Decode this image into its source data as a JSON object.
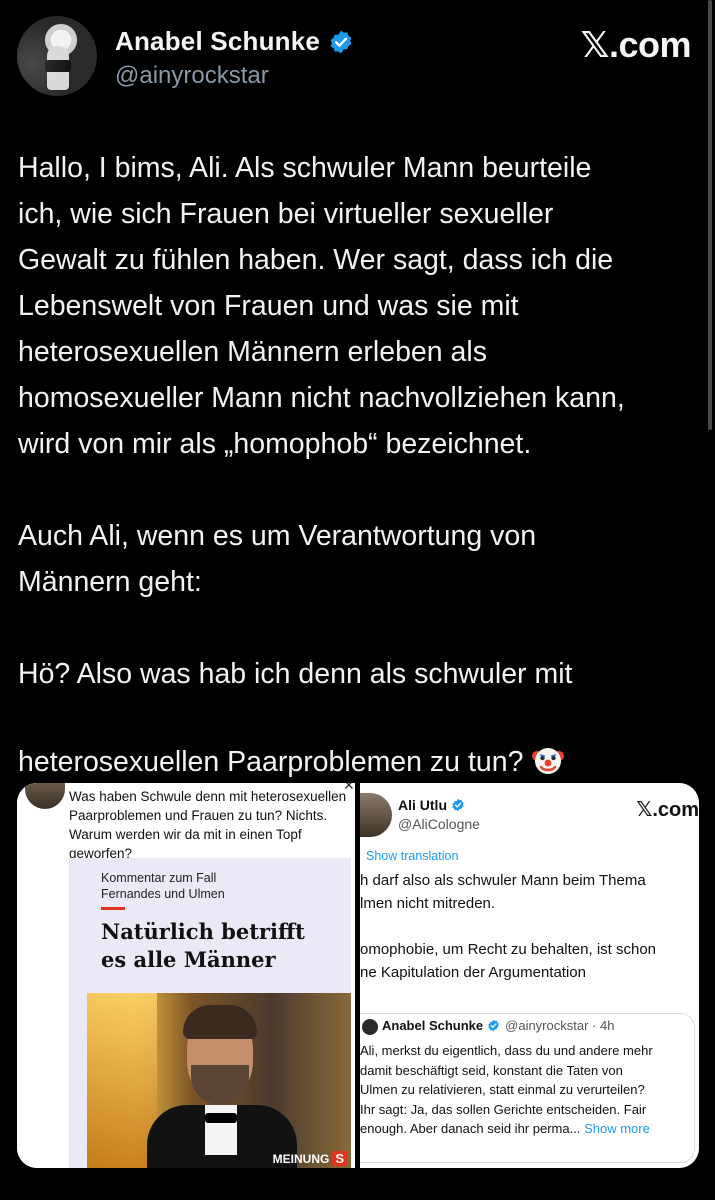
{
  "header": {
    "name": "Anabel Schunke",
    "handle": "@ainyrockstar",
    "site": "𝕏.com"
  },
  "tweet": {
    "paragraph1": "Hallo, I bims, Ali. Als schwuler Mann beurteile\nich, wie sich Frauen bei virtueller sexueller\nGewalt zu fühlen haben. Wer sagt, dass ich die\nLebenswelt von Frauen und was sie mit\nheterosexuellen Männern erleben als\nhomosexueller Mann nicht nachvollziehen kann,\nwird von mir als „homophob“ bezeichnet.",
    "paragraph2": "Auch Ali, wenn es um Verantwortung von\nMännern geht:",
    "paragraph3": "Hö? Also was hab ich denn als schwuler mit\nheterosexuellen Paarproblemen zu tun?",
    "emoji": "clown-face"
  },
  "left_screenshot": {
    "post_text": "Was haben Schwule denn mit heterosexuellen Paarproblemen und Frauen zu tun? Nichts. Warum werden wir da mit in einen Topf geworfen?",
    "card_kicker": "Kommentar zum Fall\nFernandes und Ulmen",
    "card_headline": "Natürlich betrifft\nes alle Männer",
    "badge_label": "MEINUNG",
    "badge_letter": "S"
  },
  "right_screenshot": {
    "name": "Ali Utlu",
    "handle": "@AliCologne",
    "site": "𝕏.com",
    "show_translation": "Show translation",
    "text": "h darf also als schwuler Mann beim Thema\nlmen nicht mitreden.\n\nomophobie, um Recht zu behalten, ist schon\nne Kapitulation der Argumentation",
    "quote": {
      "name": "Anabel Schunke",
      "handle_time": "@ainyrockstar · 4h",
      "text": "Ali, merkst du eigentlich, dass du und andere mehr\ndamit beschäftigt seid, konstant die Taten von\nUlmen zu relativieren, statt einmal zu verurteilen?\nIhr sagt: Ja, das sollen Gerichte entscheiden. Fair\nenough. Aber danach seid ihr perma...",
      "show_more": "Show more"
    }
  },
  "colors": {
    "background": "#000000",
    "text": "#f2f2f2",
    "handle": "#8b98a5",
    "verified": "#1d9bf0",
    "accent_red": "#e1341e"
  }
}
